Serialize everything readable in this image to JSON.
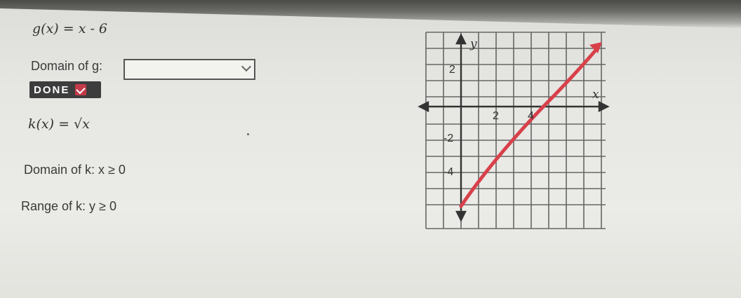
{
  "problem": {
    "g_equation": "g(x) = x - 6",
    "g_domain_label": "Domain of g:",
    "g_domain_value": "",
    "done_label": "DONE",
    "k_equation": "k(x) = √x",
    "k_domain": "Domain of k: x ≥ 0",
    "k_range": "Range of k: y ≥ 0"
  },
  "graph": {
    "y_axis_label": "y",
    "x_axis_label": "x",
    "x_tick_labels": [
      "2",
      "4"
    ],
    "y_tick_labels": [
      "2",
      "-2",
      "-4"
    ]
  },
  "colors": {
    "done_bg": "#3d3d3d",
    "done_check": "#c43a4a",
    "line": "#d8404a"
  }
}
